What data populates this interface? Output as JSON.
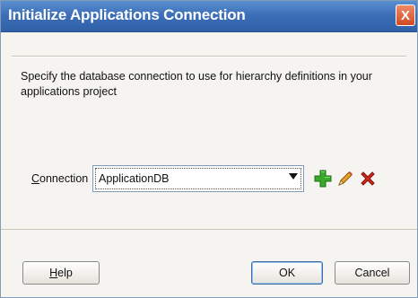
{
  "dialog": {
    "title": "Initialize Applications Connection",
    "close_symbol": "X",
    "description": "Specify the database connection to use for hierarchy definitions in your applications project"
  },
  "connection": {
    "label_first": "C",
    "label_rest": "onnection",
    "selected_value": "ApplicationDB",
    "add_icon": "plus-icon",
    "edit_icon": "pencil-icon",
    "delete_icon": "x-icon"
  },
  "buttons": {
    "help_mnemonic": "H",
    "help_rest": "elp",
    "ok_label": "OK",
    "cancel_label": "Cancel"
  },
  "colors": {
    "title_bar": "#3d6fb8",
    "add_green": "#2e9a1f",
    "edit_orange": "#d98a1a",
    "delete_red": "#d22a1a"
  }
}
